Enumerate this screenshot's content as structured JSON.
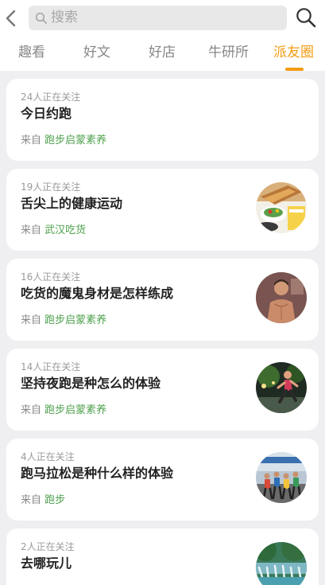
{
  "header": {
    "search_placeholder": "搜索"
  },
  "tabs": [
    {
      "label": "趣看"
    },
    {
      "label": "好文"
    },
    {
      "label": "好店"
    },
    {
      "label": "牛研所"
    },
    {
      "label": "派友圈"
    }
  ],
  "cards": [
    {
      "watchers": "24人正在关注",
      "title": "今日约跑",
      "from_prefix": "来自",
      "source": "跑步启蒙素养"
    },
    {
      "watchers": "19人正在关注",
      "title": "舌尖上的健康运动",
      "from_prefix": "来自",
      "source": "武汉吃货",
      "thumb": "food-image"
    },
    {
      "watchers": "16人正在关注",
      "title": "吃货的魔鬼身材是怎样练成",
      "from_prefix": "来自",
      "source": "跑步启蒙素养",
      "thumb": "fitness-man-image"
    },
    {
      "watchers": "14人正在关注",
      "title": "坚持夜跑是种怎么的体验",
      "from_prefix": "来自",
      "source": "跑步启蒙素养",
      "thumb": "night-runner-image"
    },
    {
      "watchers": "4人正在关注",
      "title": "跑马拉松是种什么样的体验",
      "from_prefix": "来自",
      "source": "跑步",
      "thumb": "marathon-image"
    },
    {
      "watchers": "2人正在关注",
      "title": "去哪玩儿",
      "thumb": "waterfall-image"
    }
  ],
  "colors": {
    "accent": "#f39c12",
    "source_green": "#4fa14f"
  }
}
